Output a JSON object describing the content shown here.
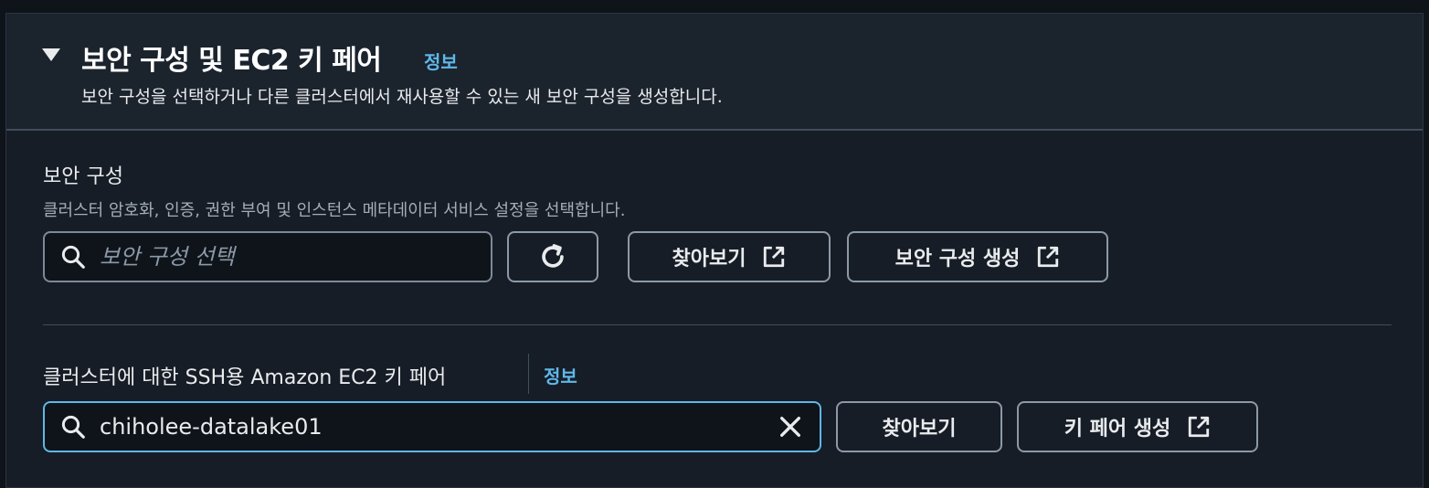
{
  "section": {
    "title": "보안 구성 및 EC2 키 페어",
    "info_label": "정보",
    "description": "보안 구성을 선택하거나 다른 클러스터에서 재사용할 수 있는 새 보안 구성을 생성합니다."
  },
  "security_config": {
    "label": "보안 구성",
    "description": "클러스터 암호화, 인증, 권한 부여 및 인스턴스 메타데이터 서비스 설정을 선택합니다.",
    "search_placeholder": "보안 구성 선택",
    "search_value": "",
    "browse_label": "찾아보기",
    "create_label": "보안 구성 생성"
  },
  "key_pair": {
    "label": "클러스터에 대한 SSH용 Amazon EC2 키 페어",
    "info_label": "정보",
    "search_value": "chiholee-datalake01",
    "browse_label": "찾아보기",
    "create_label": "키 페어 생성"
  },
  "colors": {
    "page_bg": "#0f141a",
    "panel_bg": "#161d26",
    "header_bg": "#1b232d",
    "link": "#5fb7e8",
    "focus_border": "#5fb7e8",
    "text": "#e9ebed",
    "secondary_text": "#a4adb8"
  },
  "icons": {
    "caret": "caret-down-icon",
    "search": "search-icon",
    "refresh": "refresh-icon",
    "external": "external-link-icon",
    "clear": "close-icon"
  }
}
